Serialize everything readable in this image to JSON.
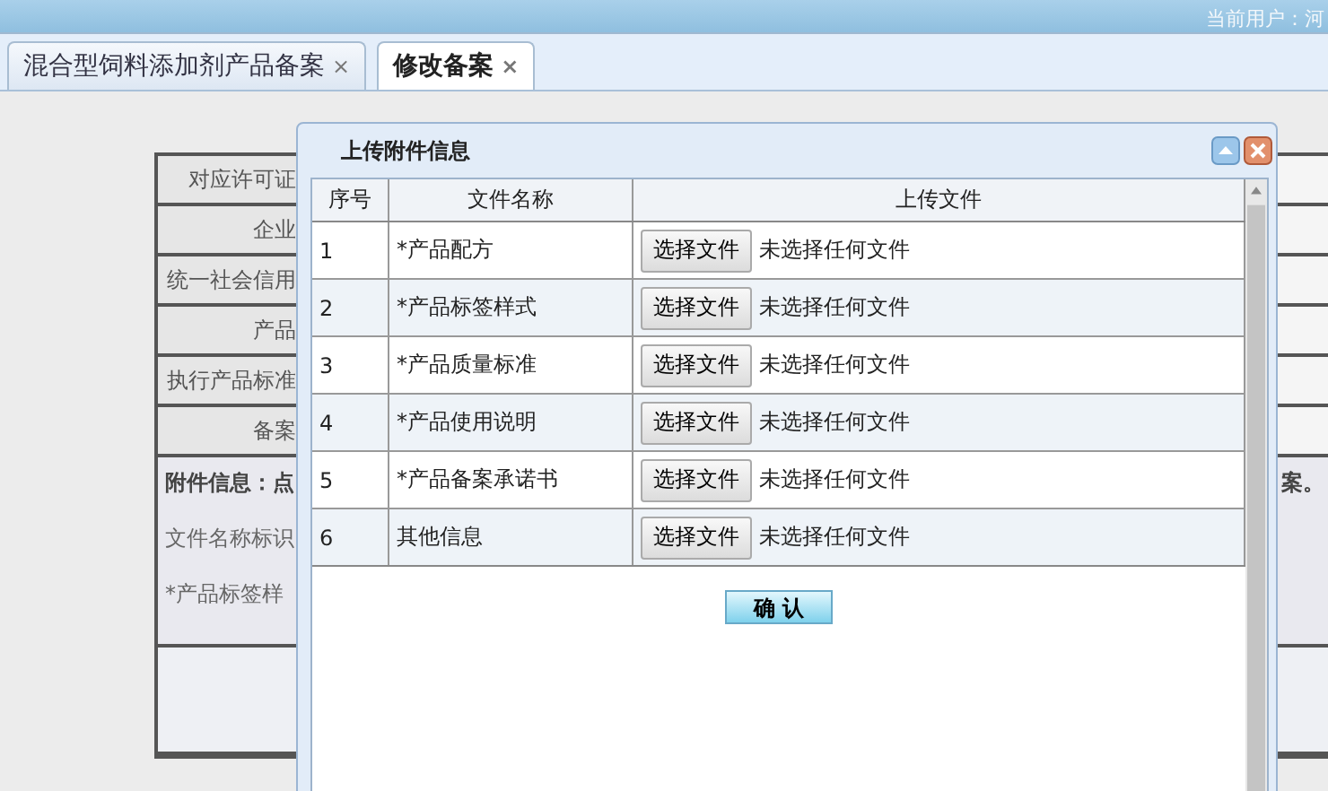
{
  "header": {
    "current_user": "当前用户：河"
  },
  "tabs": [
    {
      "label": "混合型饲料添加剂产品备案",
      "selected": false,
      "close": "×"
    },
    {
      "label": "修改备案",
      "selected": true,
      "close": "×"
    }
  ],
  "form": {
    "rows": [
      {
        "label": "对应许可证"
      },
      {
        "label": "企业"
      },
      {
        "label": "统一社会信用"
      },
      {
        "label": "产品"
      },
      {
        "label": "执行产品标准"
      },
      {
        "label": "备案"
      }
    ],
    "attachment": {
      "lead": "附件信息：点",
      "lines": [
        "文件名称标识",
        "*产品标签样"
      ],
      "tail": "案。"
    }
  },
  "dialog": {
    "title": "上传附件信息",
    "columns": [
      "序号",
      "文件名称",
      "上传文件"
    ],
    "rows": [
      {
        "no": "1",
        "name": "*产品配方",
        "button": "选择文件",
        "status": "未选择任何文件"
      },
      {
        "no": "2",
        "name": "*产品标签样式",
        "button": "选择文件",
        "status": "未选择任何文件"
      },
      {
        "no": "3",
        "name": "*产品质量标准",
        "button": "选择文件",
        "status": "未选择任何文件"
      },
      {
        "no": "4",
        "name": "*产品使用说明",
        "button": "选择文件",
        "status": "未选择任何文件"
      },
      {
        "no": "5",
        "name": "*产品备案承诺书",
        "button": "选择文件",
        "status": "未选择任何文件"
      },
      {
        "no": "6",
        "name": "其他信息",
        "button": "选择文件",
        "status": "未选择任何文件"
      }
    ],
    "confirm": "确 认"
  }
}
